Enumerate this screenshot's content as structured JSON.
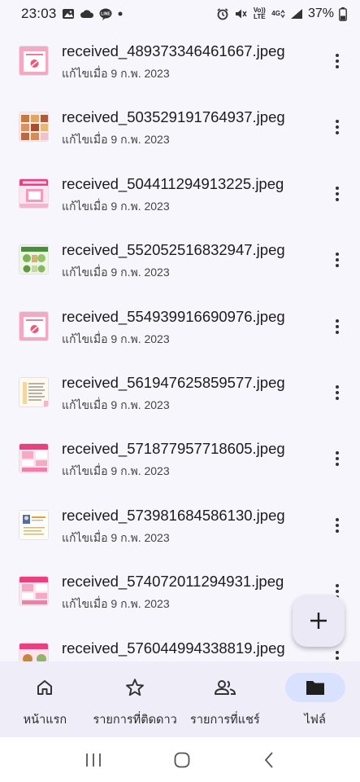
{
  "status_bar": {
    "time": "23:03",
    "left_icons": [
      "image-icon",
      "cloud-icon",
      "line-app-icon",
      "dot-icon"
    ],
    "right_icons": [
      "alarm-icon",
      "mute-icon",
      "volte-icon",
      "4g-icon",
      "signal-icon"
    ],
    "battery": "37%",
    "volte_text": "Vo)) LTE",
    "net_text": "4G"
  },
  "files": [
    {
      "name": "received_489373346461667.jpeg",
      "meta": "แก้ไขเมื่อ 9 ก.พ. 2023",
      "thumb": "pink"
    },
    {
      "name": "received_503529191764937.jpeg",
      "meta": "แก้ไขเมื่อ 9 ก.พ. 2023",
      "thumb": "food"
    },
    {
      "name": "received_504411294913225.jpeg",
      "meta": "แก้ไขเมื่อ 9 ก.พ. 2023",
      "thumb": "pinkposter"
    },
    {
      "name": "received_552052516832947.jpeg",
      "meta": "แก้ไขเมื่อ 9 ก.พ. 2023",
      "thumb": "green"
    },
    {
      "name": "received_554939916690976.jpeg",
      "meta": "แก้ไขเมื่อ 9 ก.พ. 2023",
      "thumb": "pink"
    },
    {
      "name": "received_561947625859577.jpeg",
      "meta": "แก้ไขเมื่อ 9 ก.พ. 2023",
      "thumb": "list"
    },
    {
      "name": "received_571877957718605.jpeg",
      "meta": "แก้ไขเมื่อ 9 ก.พ. 2023",
      "thumb": "pinkgrid"
    },
    {
      "name": "received_573981684586130.jpeg",
      "meta": "แก้ไขเมื่อ 9 ก.พ. 2023",
      "thumb": "doc"
    },
    {
      "name": "received_574072011294931.jpeg",
      "meta": "แก้ไขเมื่อ 9 ก.พ. 2023",
      "thumb": "pinkgrid"
    },
    {
      "name": "received_576044994338819.jpeg",
      "meta": "แก้ไขเมื่อ 9 ก.พ. 2023",
      "thumb": "foodpink"
    }
  ],
  "fab": {
    "icon": "plus-icon"
  },
  "bottom_nav": [
    {
      "label": "หน้าแรก",
      "icon": "home-icon",
      "active": false
    },
    {
      "label": "รายการที่ติดดาว",
      "icon": "star-icon",
      "active": false
    },
    {
      "label": "รายการที่แชร์",
      "icon": "people-icon",
      "active": false
    },
    {
      "label": "ไฟล์",
      "icon": "folder-icon",
      "active": true
    }
  ],
  "system_nav": [
    "recents-icon",
    "home-circle-icon",
    "back-icon"
  ],
  "colors": {
    "background": "#f7f6fd",
    "nav_background": "#efeef8",
    "active_pill": "#d8e2ff",
    "fab_background": "#ebe9f5"
  }
}
